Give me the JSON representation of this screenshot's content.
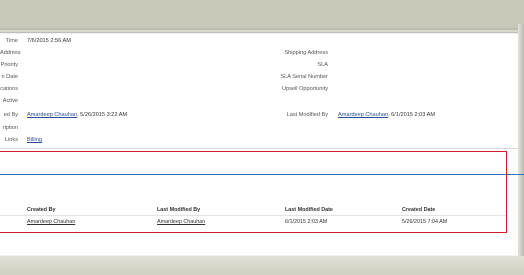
{
  "details": {
    "created_time_label": "Time",
    "created_time_value": "7/6/2015 2:56 AM",
    "address_label": "Address",
    "shipping_address_label": "Shipping Address",
    "priority_label": "Priority",
    "sla_label": "SLA",
    "expiration_date_label": "n Date",
    "sla_serial_label": "SLA Serial Number",
    "locations_label": "cations",
    "upsell_label": "Upsell Opportunity",
    "active_label": "Active",
    "created_by_label": "ed By",
    "created_by_value": "Amardeep Chauhan",
    "created_by_date": ", 5/26/2015 3:22 AM",
    "last_modified_by_label": "Last Modified By",
    "last_modified_by_value": "Amardeep Chauhan",
    "last_modified_by_date": ", 6/1/2015 2:03 AM",
    "description_label": "ription",
    "custom_links_label": "Links",
    "custom_link_value": "Billing"
  },
  "related_list": {
    "headers": [
      "Created By",
      "Last Modified By",
      "Last Modified Date",
      "Created Date"
    ],
    "rows": [
      [
        "Amardeep Chauhan",
        "Amardeep Chauhan",
        "6/1/2015 2:03 AM",
        "5/26/2015 7:04 AM"
      ]
    ]
  }
}
